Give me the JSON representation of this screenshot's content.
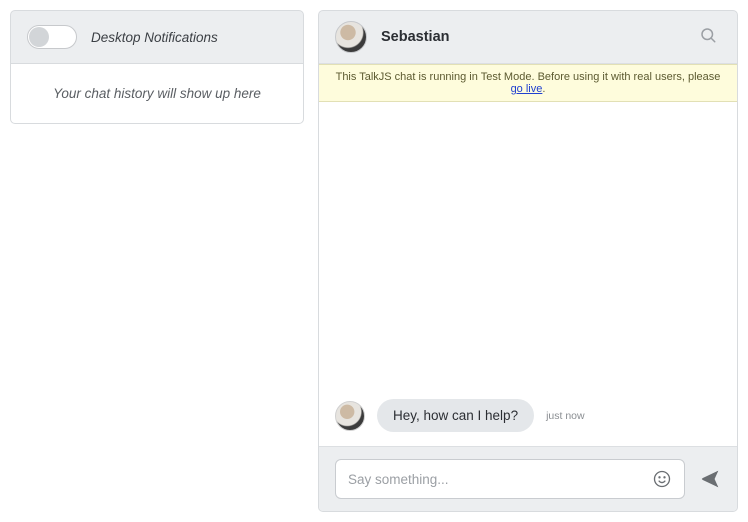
{
  "sidebar": {
    "notifications_label": "Desktop Notifications",
    "history_empty": "Your chat history will show up here"
  },
  "chat": {
    "contact_name": "Sebastian",
    "banner_prefix": "This TalkJS chat is running in Test Mode. Before using it with real users, please ",
    "banner_link": "go live",
    "banner_suffix": ".",
    "messages": [
      {
        "text": "Hey, how can I help?",
        "time": "just now"
      }
    ],
    "composer_placeholder": "Say something..."
  }
}
